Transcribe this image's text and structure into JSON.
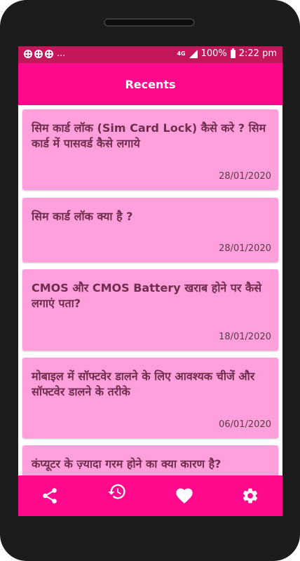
{
  "status_bar": {
    "more": "...",
    "network": "4G",
    "battery": "100%",
    "time": "2:22 pm"
  },
  "app_bar": {
    "title": "Recents"
  },
  "recents": [
    {
      "title": "सिम कार्ड लॉक (Sim Card Lock) कैसे करे ? सिम कार्ड में पासवर्ड कैसे लगाये",
      "date": "28/01/2020"
    },
    {
      "title": "सिम कार्ड लॉक क्या है ?",
      "date": "28/01/2020"
    },
    {
      "title": "CMOS और CMOS Battery खराब होने पर कैसे लगाएं पता?",
      "date": "18/01/2020"
    },
    {
      "title": "मोबाइल में सॉफ्टवेर डालने के लिए आवश्यक चीजें और सॉफ्टवेर डालने के तरीके",
      "date": "06/01/2020"
    },
    {
      "title": "कंप्यूटर के ज़्यादा गरम होने का क्या कारण है?",
      "date": ""
    }
  ],
  "bottom_nav": {
    "icons": [
      "share-icon",
      "history-icon",
      "heart-icon",
      "settings-icon"
    ]
  },
  "colors": {
    "status_bar": "#c2185b",
    "app_bar": "#ff0a8c",
    "card": "#ff9fdb",
    "card_text": "#6f2d4f"
  }
}
